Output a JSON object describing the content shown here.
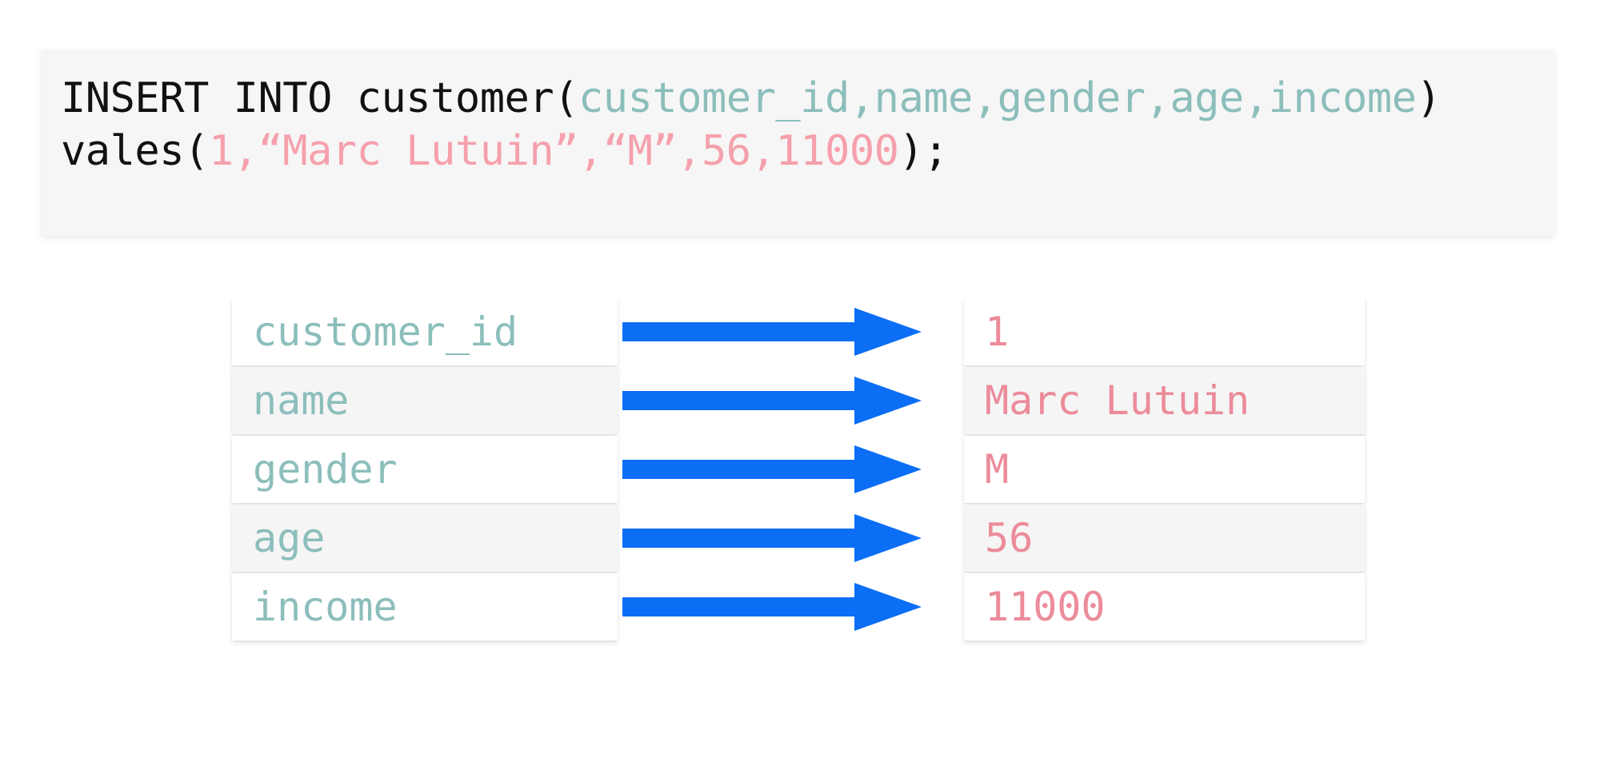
{
  "code_panel": {
    "line1": {
      "keyword": "INSERT INTO customer(",
      "columns": "customer_id,name,gender,age,income",
      "close_paren": ")"
    },
    "line2": {
      "keyword": "vales(",
      "values": "1,“Marc Lutuin”,“M”,56,11000",
      "close_paren": ");"
    },
    "full_text": "INSERT INTO customer(customer_id,name,gender,age,income) vales(1,“Marc Lutuin”,“M”,56,11000);"
  },
  "colors": {
    "column_token": "#8cbebb",
    "value_token": "#f5a0ac",
    "plain_token": "#111111",
    "arrow": "#0b6ef5",
    "left_cell_text": "#8cbebb",
    "right_cell_text": "#ec8b9a",
    "code_panel_bg": "#f6f6f6",
    "cell_white_bg": "#ffffff",
    "cell_grey_bg": "#f5f5f5"
  },
  "mapping": {
    "arrow_icon": "right-arrow-icon",
    "rows": [
      {
        "column": "customer_id",
        "value": "1",
        "shade": "white"
      },
      {
        "column": "name",
        "value": "Marc Lutuin",
        "shade": "grey"
      },
      {
        "column": "gender",
        "value": "M",
        "shade": "white"
      },
      {
        "column": "age",
        "value": "56",
        "shade": "grey"
      },
      {
        "column": "income",
        "value": "11000",
        "shade": "white"
      }
    ]
  }
}
